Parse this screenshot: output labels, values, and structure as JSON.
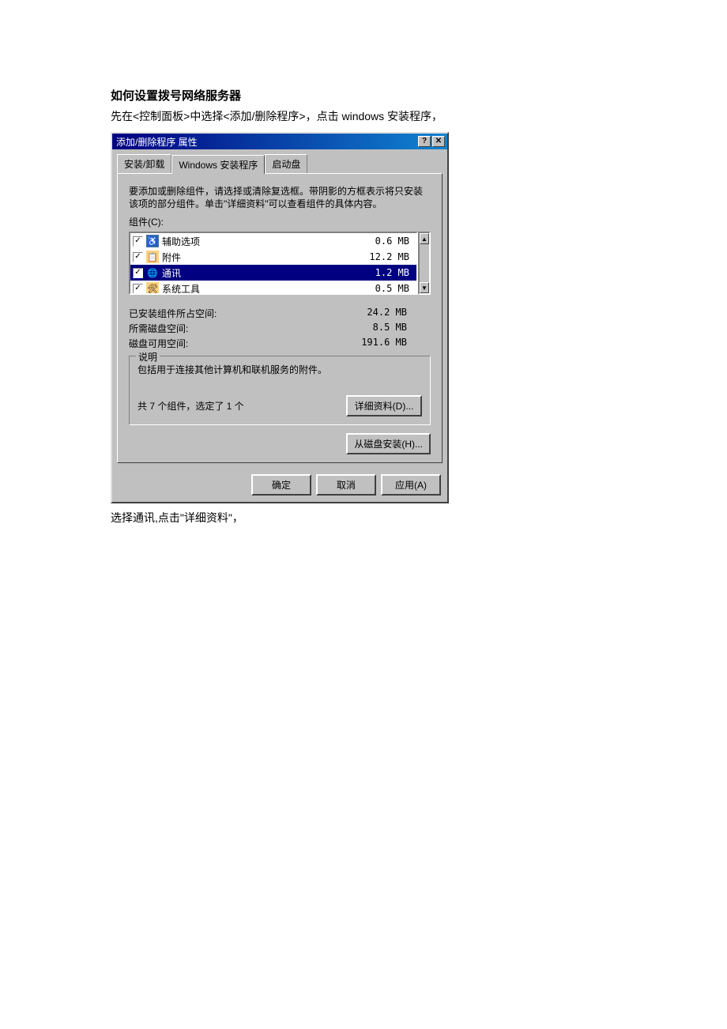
{
  "doc": {
    "title": "如何设置拨号网络服务器",
    "intro": "先在<控制面板>中选择<添加/删除程序>，点击 windows 安装程序，",
    "outro": "选择通讯,点击\"详细资料\"，"
  },
  "dialog": {
    "title": "添加/删除程序 属性",
    "help_btn": "?",
    "close_btn": "✕",
    "tabs": {
      "install": "安装/卸载",
      "windows": "Windows 安装程序",
      "boot": "启动盘"
    },
    "instructions": "要添加或删除组件，请选择或清除复选框。带阴影的方框表示将只安装该项的部分组件。单击\"详细资料\"可以查看组件的具体内容。",
    "components_label": "组件(C):",
    "components": [
      {
        "checked": true,
        "icon": "♿",
        "label": "辅助选项",
        "size": "0.6 MB",
        "selected": false,
        "iconbg": "#3a6ea5",
        "iconcolor": "#fff"
      },
      {
        "checked": true,
        "icon": "📋",
        "label": "附件",
        "size": "12.2 MB",
        "selected": false,
        "iconbg": "#ffd27f",
        "iconcolor": "#000"
      },
      {
        "checked": true,
        "icon": "🌐",
        "label": "通讯",
        "size": "1.2 MB",
        "selected": true,
        "iconbg": "#000080",
        "iconcolor": "#ffcc00"
      },
      {
        "checked": true,
        "icon": "🛠",
        "label": "系统工具",
        "size": "0.5 MB",
        "selected": false,
        "iconbg": "#ffd27f",
        "iconcolor": "#000"
      }
    ],
    "space": {
      "installed_label": "已安装组件所占空间:",
      "installed_val": "24.2 MB",
      "required_label": "所需磁盘空间:",
      "required_val": "8.5 MB",
      "available_label": "磁盘可用空间:",
      "available_val": "191.6 MB"
    },
    "description": {
      "legend": "说明",
      "text": "包括用于连接其他计算机和联机服务的附件。",
      "count_text": "共 7 个组件，选定了 1 个",
      "details_btn": "详细资料(D)..."
    },
    "disk_install_btn": "从磁盘安装(H)...",
    "footer": {
      "ok": "确定",
      "cancel": "取消",
      "apply": "应用(A)"
    }
  }
}
